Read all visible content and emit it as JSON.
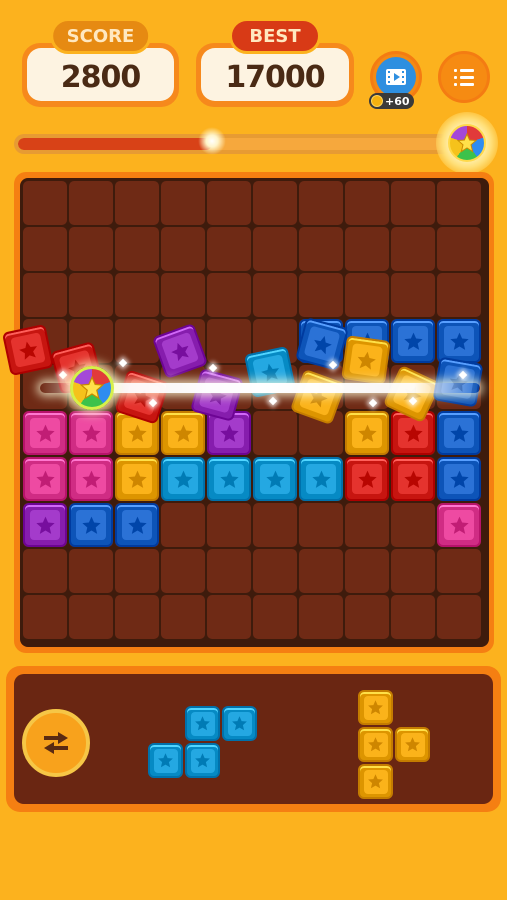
{
  "header": {
    "score": {
      "label": "SCORE",
      "value": "2800"
    },
    "best": {
      "label": "BEST",
      "value": "17000"
    },
    "video_reward": {
      "amount": "+60"
    }
  },
  "progress": {
    "fraction": 0.45
  },
  "colors": {
    "background": "#FCB21E",
    "red": "#E5332E",
    "pink": "#EE4AA2",
    "yellow": "#FBB31A",
    "cyan": "#24A8E2",
    "blue": "#2B72D6",
    "purple": "#A43BCB"
  },
  "board": {
    "rows": 10,
    "cols": 10,
    "blocks": [
      {
        "row": 3,
        "col": 6,
        "color": "blue"
      },
      {
        "row": 3,
        "col": 7,
        "color": "blue"
      },
      {
        "row": 3,
        "col": 8,
        "color": "blue"
      },
      {
        "row": 3,
        "col": 9,
        "color": "blue"
      },
      {
        "row": 5,
        "col": 0,
        "color": "pink"
      },
      {
        "row": 5,
        "col": 1,
        "color": "pink"
      },
      {
        "row": 5,
        "col": 2,
        "color": "yellow"
      },
      {
        "row": 5,
        "col": 3,
        "color": "yellow"
      },
      {
        "row": 5,
        "col": 4,
        "color": "purple"
      },
      {
        "row": 5,
        "col": 7,
        "color": "yellow"
      },
      {
        "row": 5,
        "col": 8,
        "color": "red"
      },
      {
        "row": 5,
        "col": 9,
        "color": "blue"
      },
      {
        "row": 6,
        "col": 0,
        "color": "pink"
      },
      {
        "row": 6,
        "col": 1,
        "color": "pink"
      },
      {
        "row": 6,
        "col": 2,
        "color": "yellow"
      },
      {
        "row": 6,
        "col": 3,
        "color": "cyan"
      },
      {
        "row": 6,
        "col": 4,
        "color": "cyan"
      },
      {
        "row": 6,
        "col": 5,
        "color": "cyan"
      },
      {
        "row": 6,
        "col": 6,
        "color": "cyan"
      },
      {
        "row": 6,
        "col": 7,
        "color": "red"
      },
      {
        "row": 6,
        "col": 8,
        "color": "red"
      },
      {
        "row": 6,
        "col": 9,
        "color": "blue"
      },
      {
        "row": 7,
        "col": 0,
        "color": "purple"
      },
      {
        "row": 7,
        "col": 1,
        "color": "blue"
      },
      {
        "row": 7,
        "col": 2,
        "color": "blue"
      },
      {
        "row": 7,
        "col": 9,
        "color": "pink"
      }
    ],
    "flying_blocks": [
      {
        "color": "red",
        "rotation": -12
      },
      {
        "color": "red",
        "rotation": -15
      },
      {
        "color": "red",
        "rotation": 18
      },
      {
        "color": "purple",
        "rotation": -20
      },
      {
        "color": "purple",
        "rotation": 15
      },
      {
        "color": "cyan",
        "rotation": -12
      },
      {
        "color": "yellow",
        "rotation": 20
      },
      {
        "color": "yellow",
        "rotation": 8
      },
      {
        "color": "yellow",
        "rotation": 25
      },
      {
        "color": "blue",
        "rotation": 15
      },
      {
        "color": "blue",
        "rotation": 10
      }
    ]
  },
  "tray": {
    "pieces": [
      {
        "color": "cyan",
        "shape": "S"
      },
      {
        "color": "yellow",
        "shape": "T"
      }
    ]
  }
}
